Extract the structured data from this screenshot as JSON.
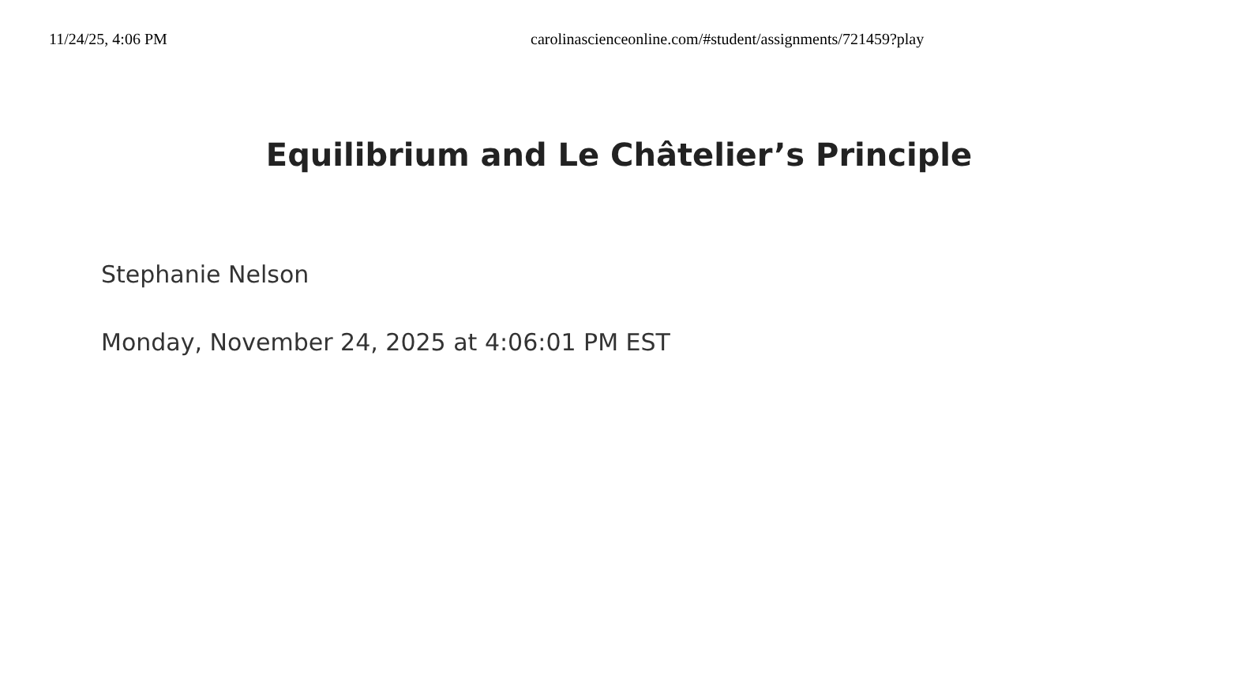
{
  "print_header": {
    "date": "11/24/25, 4:06 PM",
    "url": "carolinascienceonline.com/#student/assignments/721459?play"
  },
  "title": "Equilibrium and Le Châtelier’s Principle",
  "student": "Stephanie Nelson",
  "timestamp": "Monday, November 24, 2025 at 4:06:01 PM EST"
}
